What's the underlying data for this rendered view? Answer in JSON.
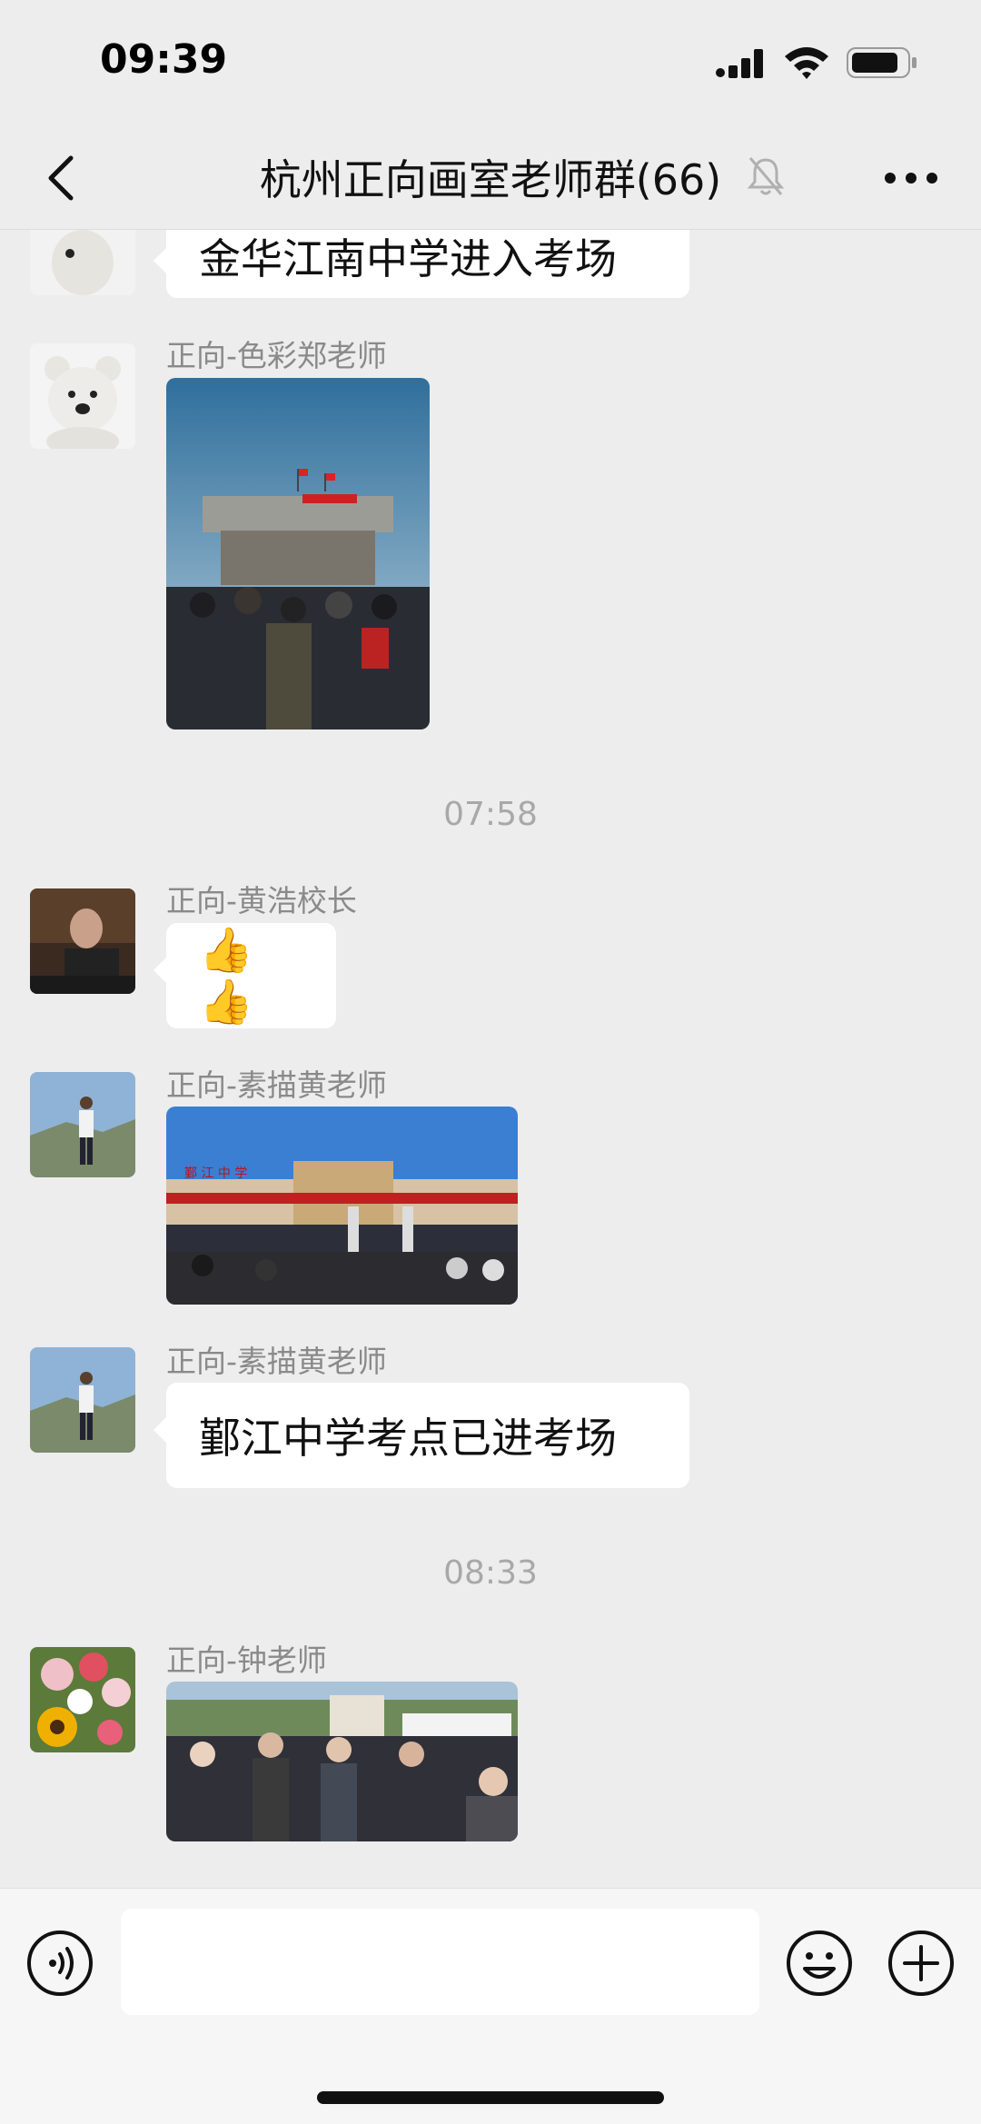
{
  "status_bar": {
    "time": "09:39"
  },
  "nav": {
    "title": "杭州正向画室老师群(66)"
  },
  "messages": [
    {
      "text": "金华江南中学进入考场"
    },
    {
      "sender": "正向-色彩郑老师"
    },
    {
      "timestamp": "07:58"
    },
    {
      "sender": "正向-黄浩校长",
      "text": "👍👍"
    },
    {
      "sender": "正向-素描黄老师"
    },
    {
      "sender": "正向-素描黄老师",
      "text": "鄞江中学考点已进考场"
    },
    {
      "timestamp": "08:33"
    },
    {
      "sender": "正向-钟老师"
    }
  ],
  "photo_signs": {
    "gate_sign": "鄞  江  中  学"
  },
  "icons": {
    "back": "chevron-left-icon",
    "mute": "bell-off-icon",
    "more": "ellipsis-icon",
    "voice": "voice-icon",
    "emoji": "smiley-icon",
    "plus": "plus-icon"
  },
  "colors": {
    "background": "#ededed",
    "bubble": "#ffffff",
    "meta_text": "#8a8a8a"
  }
}
